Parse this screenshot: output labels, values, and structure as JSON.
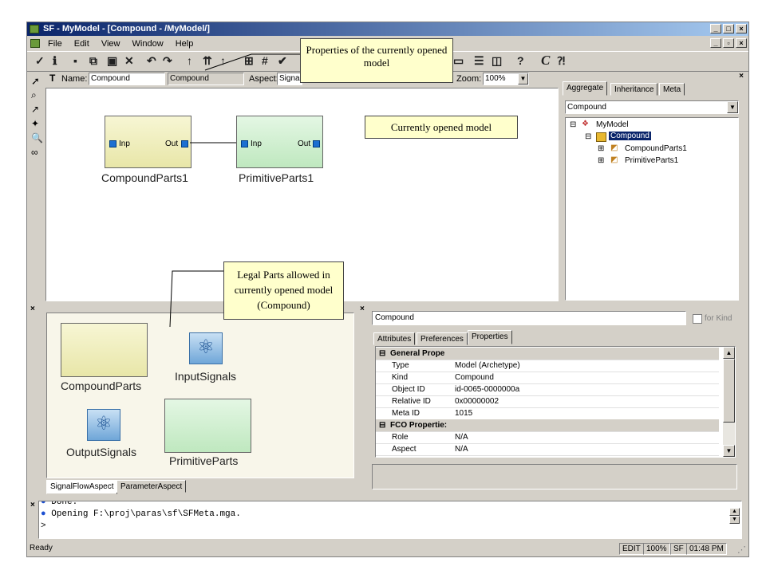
{
  "window": {
    "title": "SF - MyModel - [Compound - /MyModel/]"
  },
  "menu": [
    "File",
    "Edit",
    "View",
    "Window",
    "Help"
  ],
  "name_bar": {
    "name_label": "Name:",
    "name_value": "Compound",
    "kind_value": "Compound",
    "aspect_label": "Aspect:",
    "aspect_value": "Signa",
    "zoom_label": "Zoom:",
    "zoom_value": "100%"
  },
  "canvas": {
    "models": [
      {
        "name": "CompoundParts1",
        "in_port": "Inp",
        "out_port": "Out"
      },
      {
        "name": "PrimitiveParts1",
        "in_port": "Inp",
        "out_port": "Out"
      }
    ]
  },
  "callouts": {
    "properties": "Properties of the currently opened model",
    "opened_model": "Currently opened model",
    "legal_parts": "Legal Parts allowed in currently opened model (Compound)"
  },
  "browser": {
    "tabs": [
      "Aggregate",
      "Inheritance",
      "Meta"
    ],
    "selected_tab": "Aggregate",
    "combo_value": "Compound",
    "tree": [
      "MyModel",
      "Compound",
      "CompoundParts1",
      "PrimitiveParts1"
    ]
  },
  "parts": {
    "items": [
      "CompoundParts",
      "InputSignals",
      "OutputSignals",
      "PrimitiveParts"
    ],
    "tabs": [
      "SignalFlowAspect",
      "ParameterAspect"
    ]
  },
  "object_inspector": {
    "name_value": "Compound",
    "for_kind_label": "for Kind",
    "tabs": [
      "Attributes",
      "Preferences",
      "Properties"
    ],
    "selected_tab": "Properties",
    "groups": [
      {
        "title": "General Prope",
        "rows": [
          {
            "key": "Type",
            "value": "Model (Archetype)"
          },
          {
            "key": "Kind",
            "value": "Compound"
          },
          {
            "key": "Object ID",
            "value": "id-0065-0000000a"
          },
          {
            "key": "Relative ID",
            "value": "0x00000002"
          },
          {
            "key": "Meta ID",
            "value": "1015"
          }
        ]
      },
      {
        "title": "FCO Propertie:",
        "rows": [
          {
            "key": "Role",
            "value": "N/A"
          },
          {
            "key": "Aspect",
            "value": "N/A"
          }
        ]
      }
    ]
  },
  "console": {
    "lines": [
      "Done.",
      "Opening F:\\proj\\paras\\sf\\SFMeta.mga."
    ],
    "prompt": ">"
  },
  "status_bar": {
    "text": "Ready",
    "mode": "EDIT",
    "zoom": "100%",
    "paradigm": "SF",
    "time": "01:48 PM"
  },
  "colors": {
    "title_bar": "#0a246a",
    "compound_model": "#f2f0c0",
    "primitive_model": "#cceecc",
    "port": "#1c6fd1",
    "callout_bg": "#ffffcc"
  }
}
